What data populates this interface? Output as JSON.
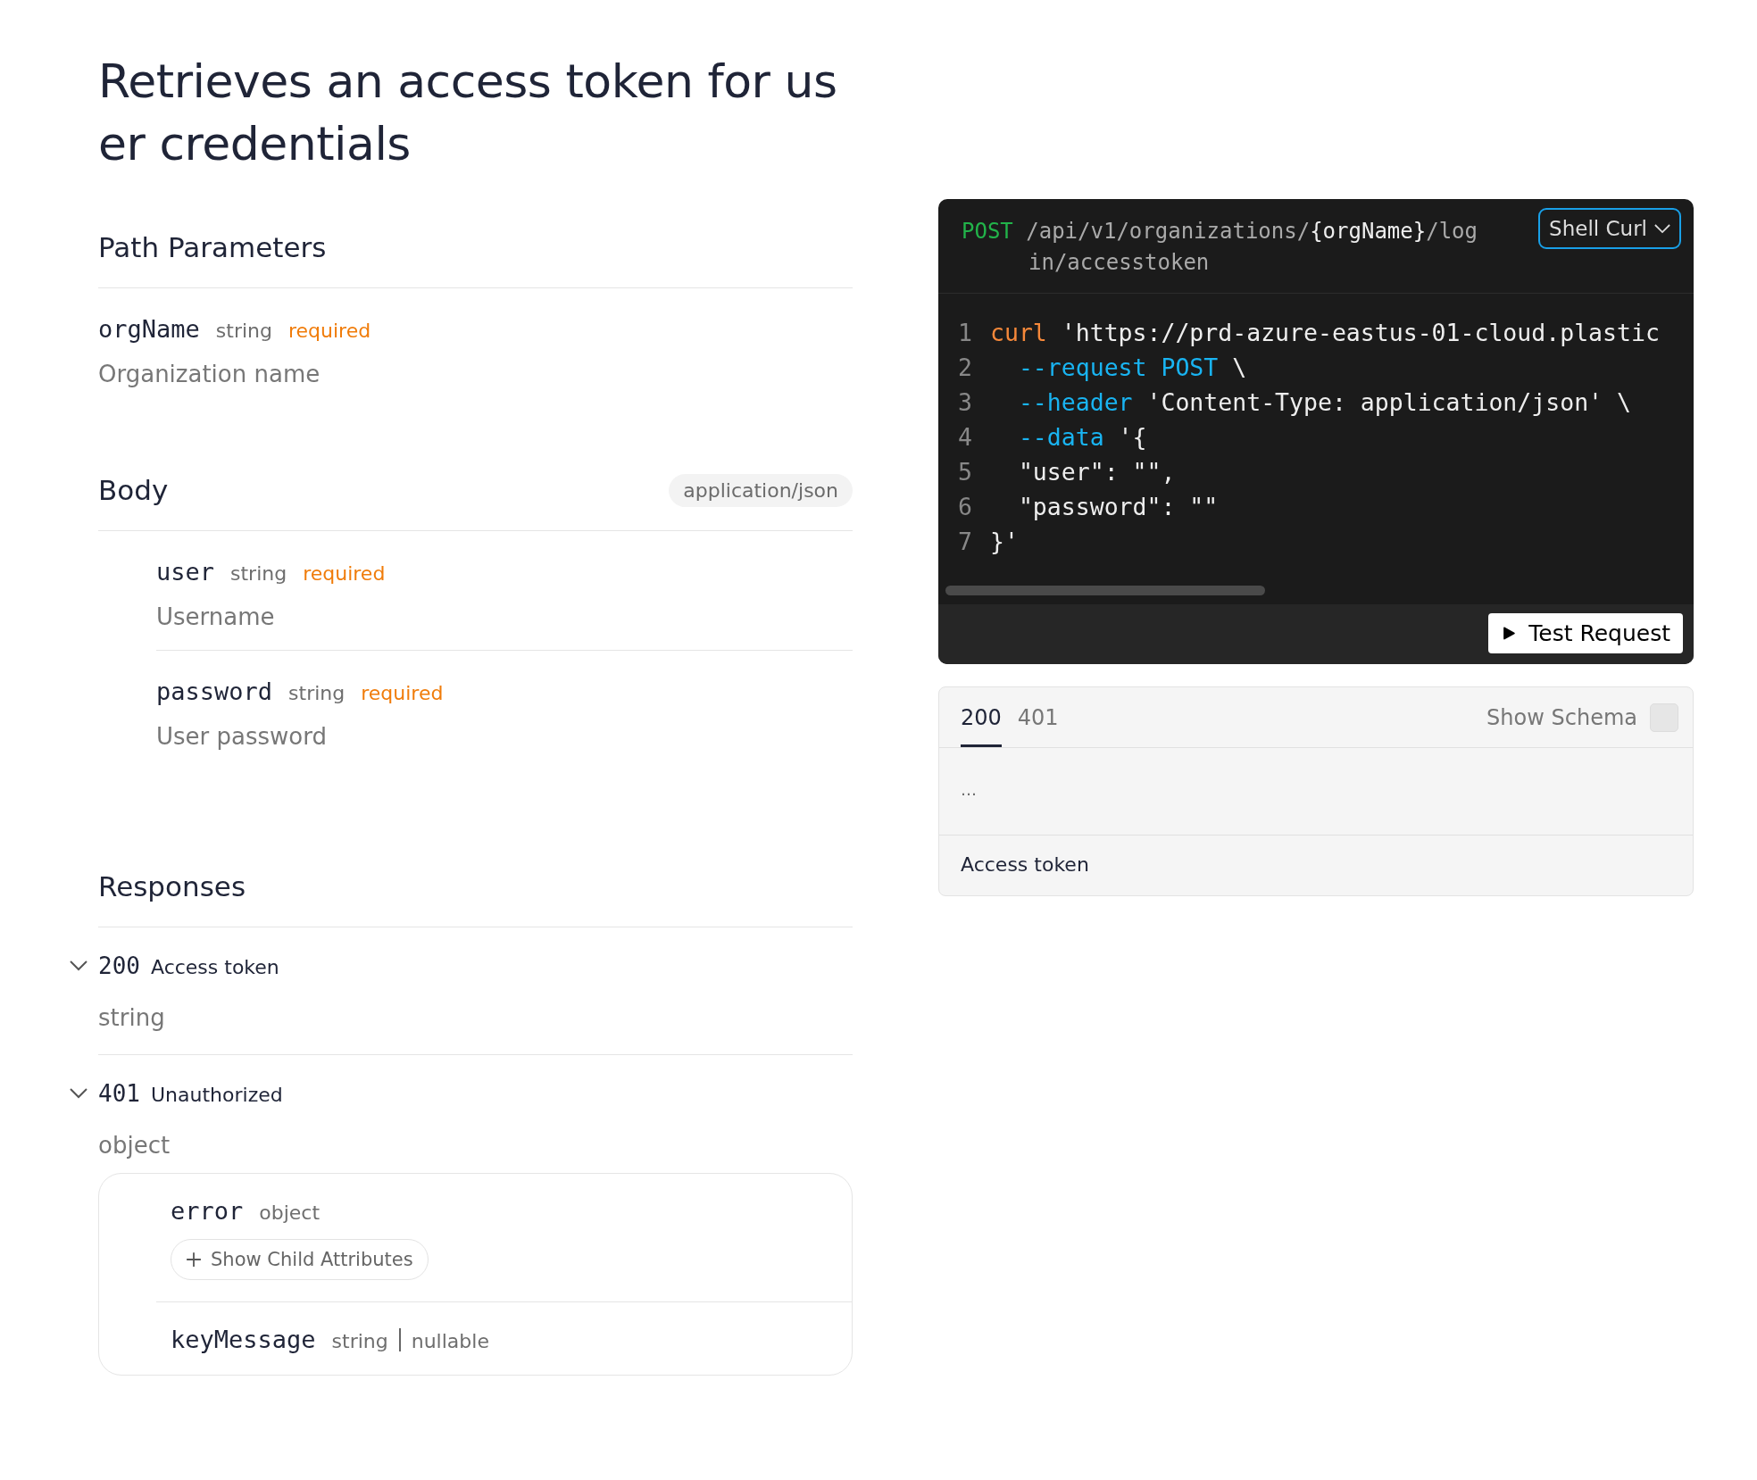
{
  "title_lines": [
    "Retrieves an access token for us",
    "er credentials"
  ],
  "path_parameters": {
    "heading": "Path Parameters",
    "params": [
      {
        "name": "orgName",
        "type": "string",
        "required": "required",
        "description": "Organization name"
      }
    ]
  },
  "body": {
    "heading": "Body",
    "content_type": "application/json",
    "params": [
      {
        "name": "user",
        "type": "string",
        "required": "required",
        "description": "Username"
      },
      {
        "name": "password",
        "type": "string",
        "required": "required",
        "description": "User password"
      }
    ]
  },
  "responses": {
    "heading": "Responses",
    "items": [
      {
        "code": "200",
        "label": "Access token",
        "expanded": true,
        "type": "string"
      },
      {
        "code": "401",
        "label": "Unauthorized",
        "expanded": true,
        "type": "object",
        "attributes": [
          {
            "name": "error",
            "type": "object",
            "button": "Show Child Attributes"
          },
          {
            "name": "keyMessage",
            "type": "string",
            "extra": "nullable"
          }
        ]
      }
    ]
  },
  "request": {
    "method": "POST",
    "path_lines": [
      "/api/v1/organizations/",
      "{orgName}",
      "/log"
    ],
    "path_cont": "in/accesstoken",
    "language": "Shell Curl",
    "code_lines": [
      {
        "number": "1",
        "tokens": [
          {
            "kind": "command",
            "text": "curl"
          },
          {
            "kind": "plain",
            "text": " 'https://prd-azure-eastus-01-cloud.plastic"
          }
        ]
      },
      {
        "number": "2",
        "tokens": [
          {
            "kind": "flag",
            "text": "  --request POST"
          },
          {
            "kind": "plain",
            "text": " \\"
          }
        ]
      },
      {
        "number": "3",
        "tokens": [
          {
            "kind": "flag",
            "text": "  --header"
          },
          {
            "kind": "plain",
            "text": " 'Content-Type: application/json' \\"
          }
        ]
      },
      {
        "number": "4",
        "tokens": [
          {
            "kind": "flag",
            "text": "  --data"
          },
          {
            "kind": "plain",
            "text": " '{"
          }
        ]
      },
      {
        "number": "5",
        "tokens": [
          {
            "kind": "plain",
            "text": "  \"user\": \"\","
          }
        ]
      },
      {
        "number": "6",
        "tokens": [
          {
            "kind": "plain",
            "text": "  \"password\": \"\""
          }
        ]
      },
      {
        "number": "7",
        "tokens": [
          {
            "kind": "plain",
            "text": "}'"
          }
        ]
      }
    ],
    "test_button": "Test Request"
  },
  "response_panel": {
    "tabs": [
      {
        "label": "200",
        "selected": true
      },
      {
        "label": "401",
        "selected": false
      }
    ],
    "show_schema": {
      "label": "Show Schema",
      "checked": false
    },
    "example": "…",
    "description": "Access token"
  }
}
